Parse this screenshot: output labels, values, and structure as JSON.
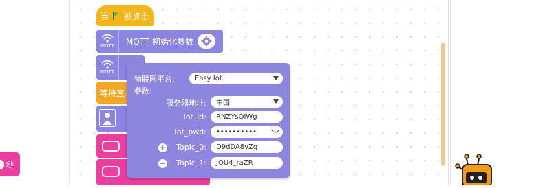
{
  "left_badge": {
    "label": "秒"
  },
  "blocks": {
    "when_clicked": {
      "prefix": "当",
      "suffix": "被点击"
    },
    "mqtt_init": {
      "label": "MQTT 初始化参数",
      "icon_label": "MQTT"
    },
    "mqtt_icon2": {
      "icon_label": "MQTT"
    },
    "wait_until": {
      "label": "等待直"
    }
  },
  "popup": {
    "platform_label": "物联网平台:",
    "platform_value": "Easy Iot",
    "params_label": "参数:",
    "server_label": "服务器地址:",
    "server_value": "中国",
    "iot_id_label": "Iot_id:",
    "iot_id_value": "RNZYsQIWg",
    "iot_pwd_label": "Iot_pwd:",
    "iot_pwd_value": "••••••••••",
    "topic0_label": "Topic_0:",
    "topic0_value": "D9dDA8yZg",
    "topic1_label": "Topic_1:",
    "topic1_value": "JOU4_raZR"
  }
}
